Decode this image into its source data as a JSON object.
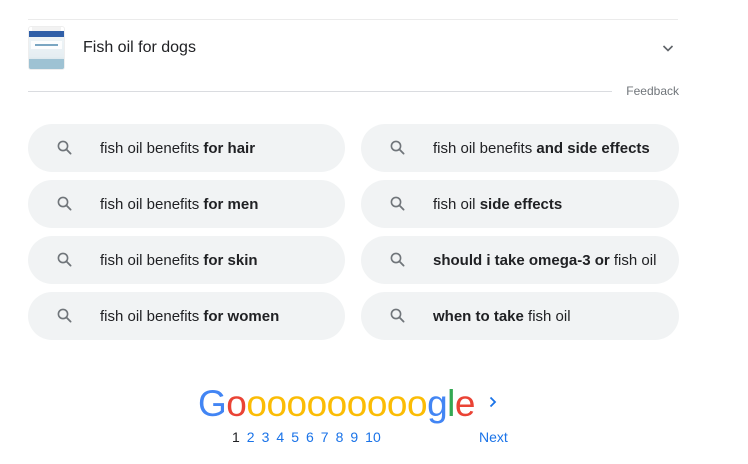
{
  "accordion": {
    "title": "Fish oil for dogs",
    "thumbnail_icon": "product-jar-thumbnail",
    "expand_icon": "chevron-down-icon"
  },
  "feedback": {
    "label": "Feedback"
  },
  "related_searches": {
    "left": [
      {
        "prefix": "fish oil benefits ",
        "bold": "for hair",
        "suffix": ""
      },
      {
        "prefix": "fish oil benefits ",
        "bold": "for men",
        "suffix": ""
      },
      {
        "prefix": "fish oil benefits ",
        "bold": "for skin",
        "suffix": ""
      },
      {
        "prefix": "fish oil benefits ",
        "bold": "for women",
        "suffix": ""
      }
    ],
    "right": [
      {
        "prefix": "fish oil benefits ",
        "bold": "and side effects",
        "suffix": ""
      },
      {
        "prefix": "fish oil ",
        "bold": "side effects",
        "suffix": ""
      },
      {
        "prefix": "",
        "bold": "should i take omega-3 or",
        "suffix": " fish oil"
      },
      {
        "prefix": "",
        "bold": "when to take",
        "suffix": " fish oil"
      }
    ]
  },
  "pagination": {
    "logo_letters": [
      {
        "ch": "G",
        "color": "#4285f4"
      },
      {
        "ch": "o",
        "color": "#ea4335"
      },
      {
        "ch": "o",
        "color": "#fbbc05"
      },
      {
        "ch": "o",
        "color": "#fbbc05"
      },
      {
        "ch": "o",
        "color": "#fbbc05"
      },
      {
        "ch": "o",
        "color": "#fbbc05"
      },
      {
        "ch": "o",
        "color": "#fbbc05"
      },
      {
        "ch": "o",
        "color": "#fbbc05"
      },
      {
        "ch": "o",
        "color": "#fbbc05"
      },
      {
        "ch": "o",
        "color": "#fbbc05"
      },
      {
        "ch": "o",
        "color": "#fbbc05"
      },
      {
        "ch": "g",
        "color": "#4285f4"
      },
      {
        "ch": "l",
        "color": "#34a853"
      },
      {
        "ch": "e",
        "color": "#ea4335"
      }
    ],
    "current_page": "1",
    "pages": [
      "2",
      "3",
      "4",
      "5",
      "6",
      "7",
      "8",
      "9",
      "10"
    ],
    "next_label": "Next"
  },
  "colors": {
    "pill_bg": "#f1f3f4",
    "link_blue": "#1a73e8",
    "text": "#202124",
    "muted": "#70757a"
  }
}
